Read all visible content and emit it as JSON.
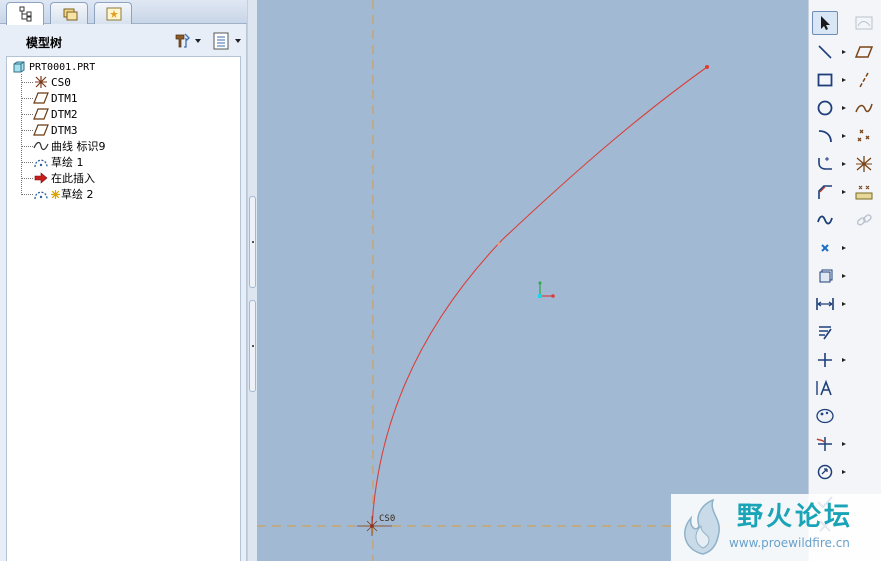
{
  "navigator": {
    "tabs": [
      {
        "name": "model-tree-tab",
        "icon": "model-tree-icon"
      },
      {
        "name": "folder-browser-tab",
        "icon": "folder-browser-icon"
      },
      {
        "name": "favorites-tab",
        "icon": "favorites-icon"
      }
    ],
    "tree_title": "模型树",
    "root": "PRT0001.PRT",
    "items": [
      {
        "label": "CS0",
        "icon": "coordinate-system-icon",
        "mono": true
      },
      {
        "label": "DTM1",
        "icon": "datum-plane-icon",
        "mono": true
      },
      {
        "label": "DTM2",
        "icon": "datum-plane-icon",
        "mono": true
      },
      {
        "label": "DTM3",
        "icon": "datum-plane-icon",
        "mono": true
      },
      {
        "label": "曲线 标识9",
        "icon": "curve-icon",
        "mono": false
      },
      {
        "label": "草绘 1",
        "icon": "sketch-icon",
        "mono": false
      },
      {
        "label": "在此插入",
        "icon": "insert-here-icon",
        "mono": false
      },
      {
        "label": "草绘 2",
        "icon": "sketch-icon",
        "mono": false,
        "prefix_icon": "active-feature-icon"
      }
    ]
  },
  "graphics": {
    "coord_sys_label": "CS0",
    "colors": {
      "background": "#a2b9d4",
      "curve": "#d8403a",
      "reference_line": "#d59a3c"
    }
  },
  "toolbar": {
    "left_column": [
      {
        "name": "select-tool",
        "icon": "arrow-pointer-icon",
        "selected": true,
        "dropdown": false
      },
      {
        "name": "line-tool",
        "icon": "line-icon",
        "dropdown": true
      },
      {
        "name": "rectangle-tool",
        "icon": "rectangle-icon",
        "dropdown": true
      },
      {
        "name": "circle-tool",
        "icon": "circle-icon",
        "dropdown": true
      },
      {
        "name": "arc-tool",
        "icon": "arc-icon",
        "dropdown": true
      },
      {
        "name": "fillet-tool",
        "icon": "fillet-icon",
        "dropdown": true
      },
      {
        "name": "chamfer-tool",
        "icon": "chamfer-icon",
        "dropdown": true
      },
      {
        "name": "spline-tool",
        "icon": "spline-icon",
        "dropdown": false
      },
      {
        "name": "point-tool",
        "icon": "point-icon",
        "dropdown": true
      },
      {
        "name": "offset-edge-tool",
        "icon": "offset-edge-icon",
        "dropdown": true
      },
      {
        "name": "dimension-tool",
        "icon": "dimension-icon",
        "dropdown": true
      },
      {
        "name": "modify-tool",
        "icon": "modify-icon",
        "dropdown": false
      },
      {
        "name": "constraint-tool",
        "icon": "constraint-icon",
        "dropdown": true
      },
      {
        "name": "text-tool",
        "icon": "text-icon",
        "dropdown": false
      },
      {
        "name": "palette-tool",
        "icon": "palette-icon",
        "dropdown": false
      },
      {
        "name": "trim-tool",
        "icon": "trim-icon",
        "dropdown": true
      },
      {
        "name": "rotate-resize-tool",
        "icon": "rotate-resize-icon",
        "dropdown": true
      },
      {
        "name": "accept-button",
        "icon": "checkmark-icon",
        "dropdown": false
      },
      {
        "name": "cancel-button",
        "icon": "close-icon",
        "dropdown": false
      }
    ],
    "right_column": [
      {
        "name": "sketch-view-tool",
        "icon": "sketch-view-icon",
        "disabled": true
      },
      {
        "name": "datum-plane-tool",
        "icon": "datum-plane-icon"
      },
      {
        "name": "datum-axis-tool",
        "icon": "datum-axis-icon"
      },
      {
        "name": "datum-curve-tool",
        "icon": "datum-curve-icon"
      },
      {
        "name": "datum-point-tool",
        "icon": "datum-point-icon"
      },
      {
        "name": "datum-csys-tool",
        "icon": "datum-csys-icon"
      },
      {
        "name": "analysis-tool",
        "icon": "analysis-icon"
      },
      {
        "name": "chain-tool",
        "icon": "chain-icon",
        "disabled": true
      }
    ]
  },
  "watermark": {
    "title": "野火论坛",
    "url": "www.proewildfire.cn"
  }
}
